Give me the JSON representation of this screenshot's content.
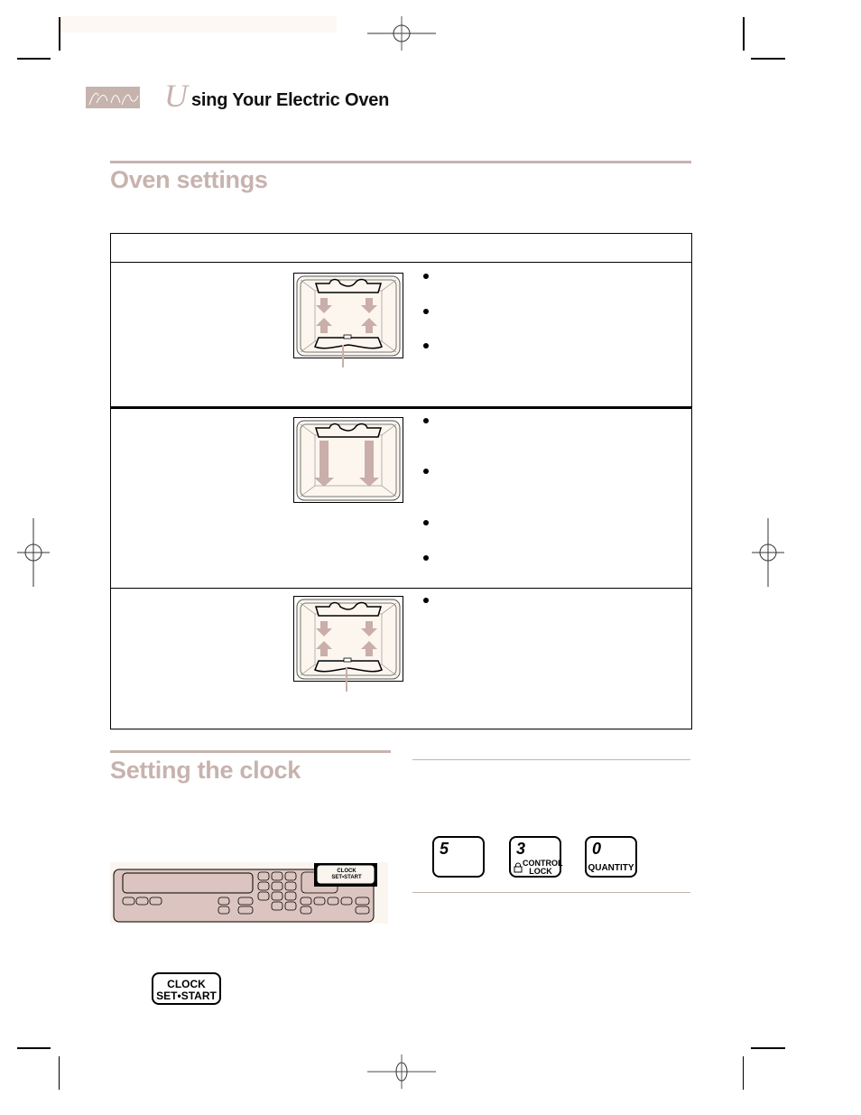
{
  "header": {
    "drop_cap": "U",
    "title_rest": "sing Your Electric Oven",
    "logo_icon": "signature-logo-icon"
  },
  "sections": {
    "oven_settings": {
      "title": "Oven settings",
      "table": {
        "header_text": "",
        "rows": [
          {
            "label": "",
            "diagram": "bake-airflow-diagram",
            "bullets": [
              "",
              "",
              ""
            ]
          },
          {
            "label": "",
            "diagram": "broil-airflow-diagram",
            "bullets": [
              "",
              "",
              "",
              ""
            ]
          },
          {
            "label": "",
            "diagram": "convection-airflow-diagram",
            "bullets": [
              ""
            ]
          }
        ]
      }
    },
    "setting_clock": {
      "title": "Setting the clock",
      "panel_highlight": {
        "line1": "CLOCK",
        "line2": "SET•START"
      },
      "clock_button": {
        "line1": "CLOCK",
        "line2": "SET•START"
      },
      "keys": [
        {
          "number": "5",
          "sub": ""
        },
        {
          "number": "3",
          "sub_line1": "CONTROL",
          "sub_line2": "LOCK",
          "icon": "lock-icon"
        },
        {
          "number": "0",
          "sub": "QUANTITY"
        }
      ]
    }
  },
  "colors": {
    "accent": "#c7b3ae",
    "panel_fill": "#dcc5c0",
    "arrow_fill": "#c9aeaa",
    "tint": "#fdf8f2"
  }
}
